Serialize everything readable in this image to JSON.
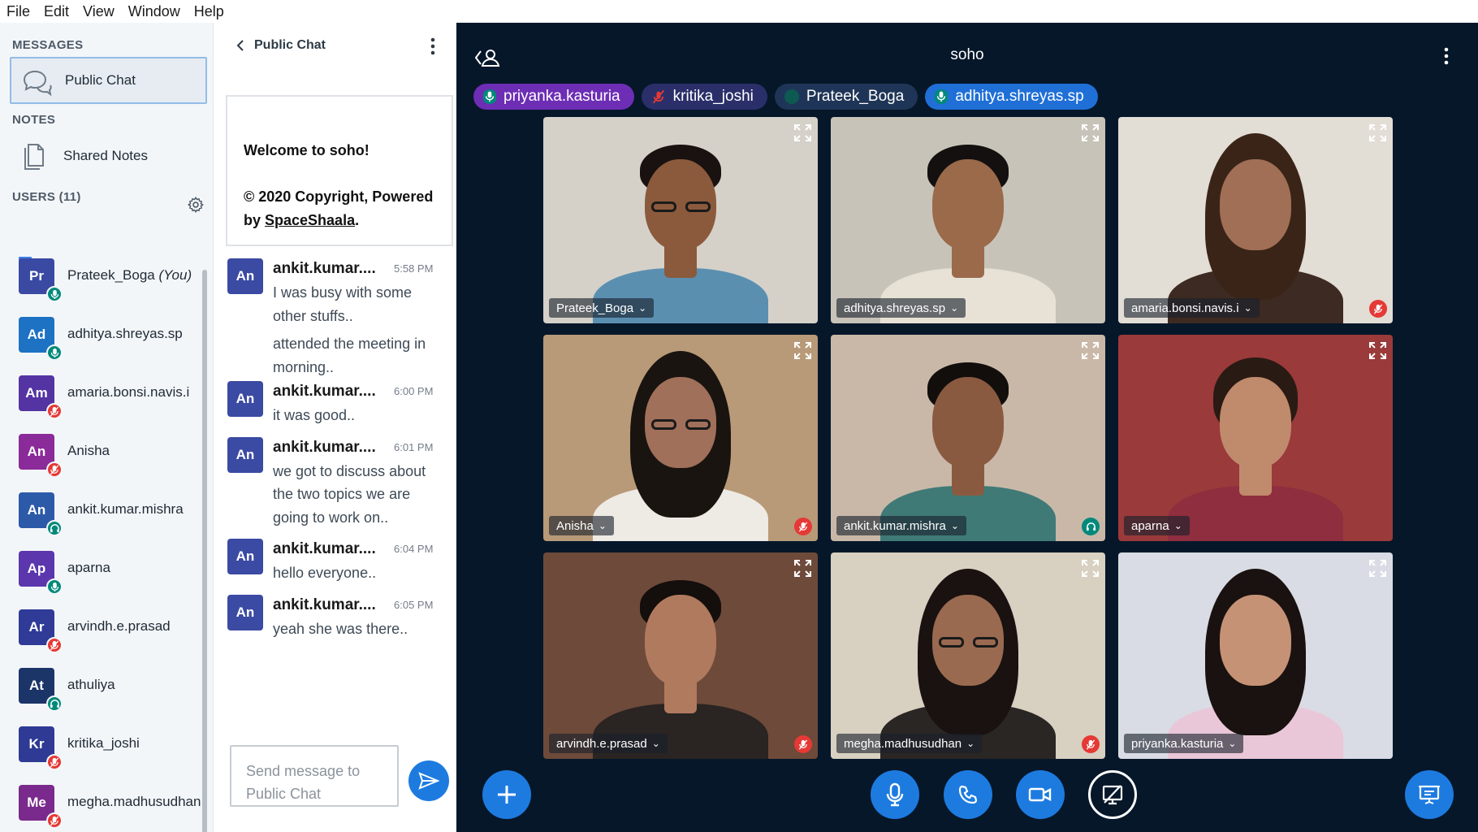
{
  "menu": [
    "File",
    "Edit",
    "View",
    "Window",
    "Help"
  ],
  "sidebar": {
    "messages_title": "MESSAGES",
    "public_chat": "Public Chat",
    "notes_title": "NOTES",
    "shared_notes": "Shared Notes",
    "users_title": "USERS (11)",
    "users": [
      {
        "initials": "Pr",
        "name": "Prateek_Boga",
        "you": "(You)",
        "color": "#3a4aa3",
        "status": "mic",
        "status_color": "#00897b",
        "presenter": true
      },
      {
        "initials": "Ad",
        "name": "adhitya.shreyas.sp",
        "color": "#1e72c3",
        "status": "mic",
        "status_color": "#00897b"
      },
      {
        "initials": "Am",
        "name": "amaria.bonsi.navis.i",
        "color": "#5433a3",
        "status": "mic-off",
        "status_color": "#e53935"
      },
      {
        "initials": "An",
        "name": "Anisha",
        "color": "#8b2a99",
        "status": "mic-off",
        "status_color": "#e53935"
      },
      {
        "initials": "An",
        "name": "ankit.kumar.mishra",
        "color": "#2c5aa8",
        "status": "listen",
        "status_color": "#00897b"
      },
      {
        "initials": "Ap",
        "name": "aparna",
        "color": "#5b36ad",
        "status": "mic",
        "status_color": "#00897b"
      },
      {
        "initials": "Ar",
        "name": "arvindh.e.prasad",
        "color": "#2f3b97",
        "status": "mic-off",
        "status_color": "#e53935"
      },
      {
        "initials": "At",
        "name": "athuliya",
        "color": "#1c3569",
        "status": "listen",
        "status_color": "#00897b"
      },
      {
        "initials": "Kr",
        "name": "kritika_joshi",
        "color": "#2e3a93",
        "status": "mic-off",
        "status_color": "#e53935"
      },
      {
        "initials": "Me",
        "name": "megha.madhusudhan",
        "color": "#7a2a8c",
        "status": "mic-off",
        "status_color": "#e53935"
      }
    ]
  },
  "chat": {
    "title": "Public Chat",
    "welcome_prefix": "Welcome to ",
    "welcome_room": "soho",
    "welcome_suffix": "!",
    "copyright_prefix": "© 2020 Copyright, Powered by ",
    "copyright_link": "SpaceShaala",
    "copyright_suffix": ".",
    "messages": [
      {
        "initials": "An",
        "name": "ankit.kumar....",
        "time": "5:58 PM",
        "lines": [
          "I was busy with some other stuffs..",
          "attended the meeting in morning.."
        ]
      },
      {
        "initials": "An",
        "name": "ankit.kumar....",
        "time": "6:00 PM",
        "lines": [
          "it was good.."
        ]
      },
      {
        "initials": "An",
        "name": "ankit.kumar....",
        "time": "6:01 PM",
        "lines": [
          "we got to discuss about the two topics we are going to work on.."
        ]
      },
      {
        "initials": "An",
        "name": "ankit.kumar....",
        "time": "6:04 PM",
        "lines": [
          "hello everyone.."
        ]
      },
      {
        "initials": "An",
        "name": "ankit.kumar....",
        "time": "6:05 PM",
        "lines": [
          "yeah she was there.."
        ]
      }
    ],
    "input_placeholder": "Send message to Public Chat"
  },
  "main": {
    "room_title": "soho",
    "talkers": [
      {
        "name": "priyanka.kasturia",
        "state": "talking",
        "bg": "#6d2db5"
      },
      {
        "name": "kritika_joshi",
        "state": "muted",
        "bg": "#2a2f6a"
      },
      {
        "name": "Prateek_Boga",
        "state": "idle",
        "bg": "#1f3557"
      },
      {
        "name": "adhitya.shreyas.sp",
        "state": "talking",
        "bg": "#1f6fd6"
      }
    ],
    "tiles": [
      {
        "name": "Prateek_Boga",
        "status": "none",
        "bg": "#d5d1c9",
        "skin": "#8b5a3c",
        "hair": "#1a1210",
        "shirt": "#5b8fb0",
        "glasses": true,
        "hair_style": "short"
      },
      {
        "name": "adhitya.shreyas.sp",
        "status": "none",
        "bg": "#c8c3b9",
        "skin": "#9a6a4a",
        "hair": "#141010",
        "shirt": "#e8e2d6",
        "glasses": false,
        "hair_style": "short"
      },
      {
        "name": "amaria.bonsi.navis.i",
        "status": "mic-off",
        "bg": "#e2ddd5",
        "skin": "#a06f55",
        "hair": "#3a2418",
        "shirt": "#3d2a22",
        "glasses": false,
        "hair_style": "long"
      },
      {
        "name": "Anisha",
        "status": "mic-off",
        "bg": "#b89a78",
        "skin": "#a0705a",
        "hair": "#1a1410",
        "shirt": "#eeeae4",
        "glasses": true,
        "hair_style": "long"
      },
      {
        "name": "ankit.kumar.mishra",
        "status": "listen",
        "bg": "#c9b8a8",
        "skin": "#8a5a40",
        "hair": "#120e0c",
        "shirt": "#3f7a76",
        "glasses": false,
        "hair_style": "short"
      },
      {
        "name": "aparna",
        "status": "none",
        "bg": "#9a3a3a",
        "skin": "#c08a6c",
        "hair": "#2a1a14",
        "shirt": "#8e2e3e",
        "glasses": false,
        "hair_style": "bun"
      },
      {
        "name": "arvindh.e.prasad",
        "status": "mic-off",
        "bg": "#6e4a3a",
        "skin": "#b07a5e",
        "hair": "#140e0c",
        "shirt": "#2a2422",
        "glasses": false,
        "hair_style": "short"
      },
      {
        "name": "megha.madhusudhan",
        "status": "mic-off",
        "bg": "#d8d0c0",
        "skin": "#9a6a50",
        "hair": "#1a1210",
        "shirt": "#2a2624",
        "glasses": true,
        "hair_style": "long"
      },
      {
        "name": "priyanka.kasturia",
        "status": "none",
        "bg": "#d9dce4",
        "skin": "#c69276",
        "hair": "#1a1210",
        "shirt": "#e9c7d8",
        "glasses": false,
        "hair_style": "long"
      }
    ],
    "controls": [
      "plus-icon",
      "microphone-icon",
      "phone-icon",
      "video-camera-icon",
      "screen-share-off-icon",
      "presentation-icon"
    ]
  },
  "colors": {
    "accent": "#1d7be0",
    "main_bg": "#06172a",
    "sidebar_bg": "#f3f6f9",
    "talking": "#00897b",
    "muted": "#e53935"
  }
}
